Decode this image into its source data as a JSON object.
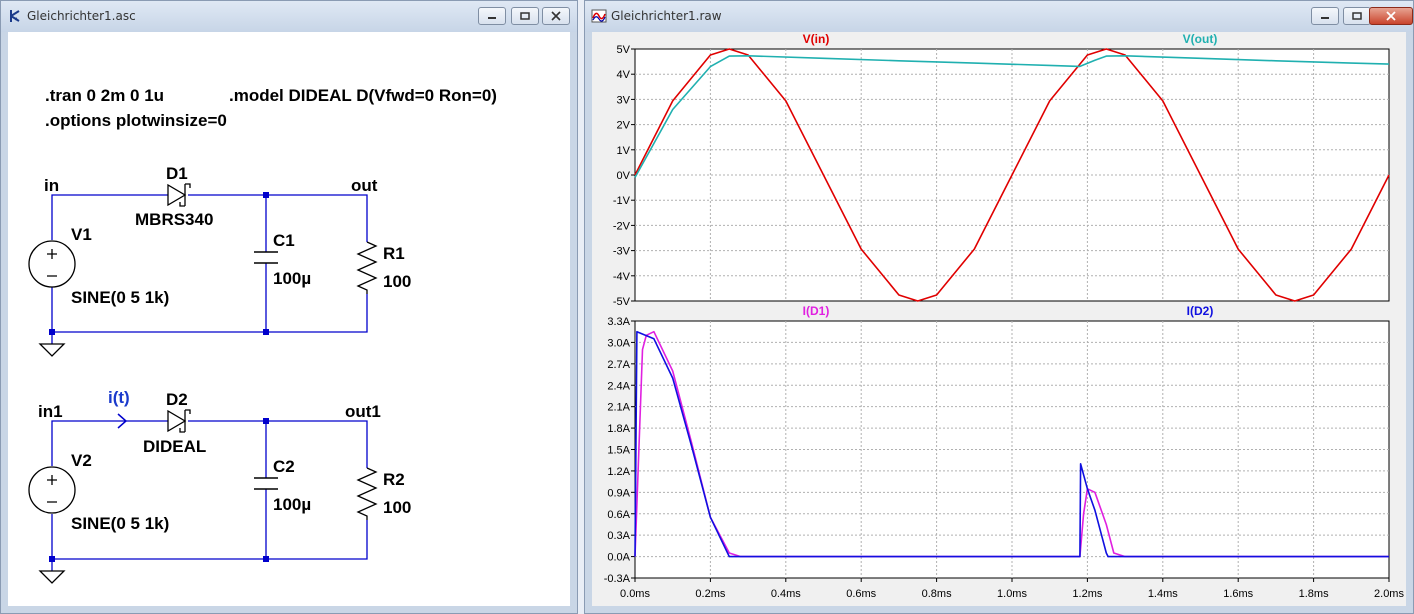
{
  "schematic_window": {
    "title": "Gleichrichter1.asc",
    "directives": [
      ".tran 0 2m 0 1u",
      ".model DIDEAL D(Vfwd=0 Ron=0)",
      ".options plotwinsize=0"
    ],
    "circuit1": {
      "net_in": "in",
      "net_out": "out",
      "diode_name": "D1",
      "diode_model": "MBRS340",
      "cap_name": "C1",
      "cap_value": "100µ",
      "res_name": "R1",
      "res_value": "100",
      "src_name": "V1",
      "src_value": "SINE(0 5 1k)"
    },
    "circuit2": {
      "net_in": "in1",
      "net_out": "out1",
      "current_label": "i(t)",
      "diode_name": "D2",
      "diode_model": "DIDEAL",
      "cap_name": "C2",
      "cap_value": "100µ",
      "res_name": "R2",
      "res_value": "100",
      "src_name": "V2",
      "src_value": "SINE(0 5 1k)"
    }
  },
  "waveform_window": {
    "title": "Gleichrichter1.raw",
    "x_tick_labels": [
      "0.0ms",
      "0.2ms",
      "0.4ms",
      "0.6ms",
      "0.8ms",
      "1.0ms",
      "1.2ms",
      "1.4ms",
      "1.6ms",
      "1.8ms",
      "2.0ms"
    ],
    "pane1_trace_labels": [
      "V(in)",
      "V(out)"
    ],
    "pane1_y_tick_labels": [
      "5V",
      "4V",
      "3V",
      "2V",
      "1V",
      "0V",
      "-1V",
      "-2V",
      "-3V",
      "-4V",
      "-5V"
    ],
    "pane2_trace_labels": [
      "I(D1)",
      "I(D2)"
    ],
    "pane2_y_tick_labels": [
      "3.3A",
      "3.0A",
      "2.7A",
      "2.4A",
      "2.1A",
      "1.8A",
      "1.5A",
      "1.2A",
      "0.9A",
      "0.6A",
      "0.3A",
      "0.0A",
      "-0.3A"
    ]
  },
  "colors": {
    "wire": "#0000cc",
    "trace_vin": "#e00000",
    "trace_vout": "#20b0b0",
    "trace_id1": "#e020e0",
    "trace_id2": "#1010e0",
    "grid": "#b0b0b0"
  },
  "chart_data": [
    {
      "type": "line",
      "title": "",
      "xlabel": "",
      "ylabel": "",
      "xlim": [
        0,
        2.0
      ],
      "ylim": [
        -5,
        5
      ],
      "x_unit": "ms",
      "y_unit": "V",
      "grid": true,
      "legend": "top",
      "series": [
        {
          "name": "V(in)",
          "x": [
            0,
            0.1,
            0.2,
            0.25,
            0.3,
            0.4,
            0.5,
            0.6,
            0.7,
            0.75,
            0.8,
            0.9,
            1.0,
            1.1,
            1.2,
            1.25,
            1.3,
            1.4,
            1.5,
            1.6,
            1.7,
            1.75,
            1.8,
            1.9,
            2.0
          ],
          "values": [
            0,
            2.94,
            4.76,
            5.0,
            4.76,
            2.94,
            0,
            -2.94,
            -4.76,
            -5.0,
            -4.76,
            -2.94,
            0,
            2.94,
            4.76,
            5.0,
            4.76,
            2.94,
            0,
            -2.94,
            -4.76,
            -5.0,
            -4.76,
            -2.94,
            0
          ]
        },
        {
          "name": "V(out)",
          "x": [
            0,
            0.1,
            0.2,
            0.25,
            0.3,
            0.5,
            0.7,
            0.9,
            1.1,
            1.18,
            1.22,
            1.25,
            1.3,
            1.5,
            1.7,
            1.9,
            2.0
          ],
          "values": [
            -0.1,
            2.6,
            4.3,
            4.72,
            4.73,
            4.63,
            4.53,
            4.44,
            4.35,
            4.31,
            4.55,
            4.72,
            4.73,
            4.63,
            4.53,
            4.44,
            4.4
          ]
        }
      ]
    },
    {
      "type": "line",
      "title": "",
      "xlabel": "",
      "ylabel": "",
      "xlim": [
        0,
        2.0
      ],
      "ylim": [
        -0.3,
        3.3
      ],
      "x_unit": "ms",
      "y_unit": "A",
      "grid": true,
      "legend": "top",
      "series": [
        {
          "name": "I(D1)",
          "x": [
            0,
            0.02,
            0.03,
            0.05,
            0.1,
            0.15,
            0.2,
            0.25,
            0.28,
            0.3,
            1.0,
            1.18,
            1.19,
            1.2,
            1.22,
            1.25,
            1.27,
            1.3,
            2.0
          ],
          "values": [
            0,
            2.9,
            3.1,
            3.15,
            2.6,
            1.6,
            0.55,
            0.05,
            0,
            0,
            0,
            0,
            0.6,
            0.95,
            0.9,
            0.45,
            0.05,
            0,
            0
          ]
        },
        {
          "name": "I(D2)",
          "x": [
            0,
            0.005,
            0.05,
            0.1,
            0.15,
            0.2,
            0.25,
            0.26,
            0.3,
            1.0,
            1.18,
            1.182,
            1.2,
            1.22,
            1.25,
            1.255,
            1.3,
            2.0
          ],
          "values": [
            0,
            3.15,
            3.05,
            2.5,
            1.55,
            0.55,
            0,
            0,
            0,
            0,
            0,
            1.3,
            0.95,
            0.65,
            0.05,
            0,
            0,
            0
          ]
        }
      ]
    }
  ]
}
